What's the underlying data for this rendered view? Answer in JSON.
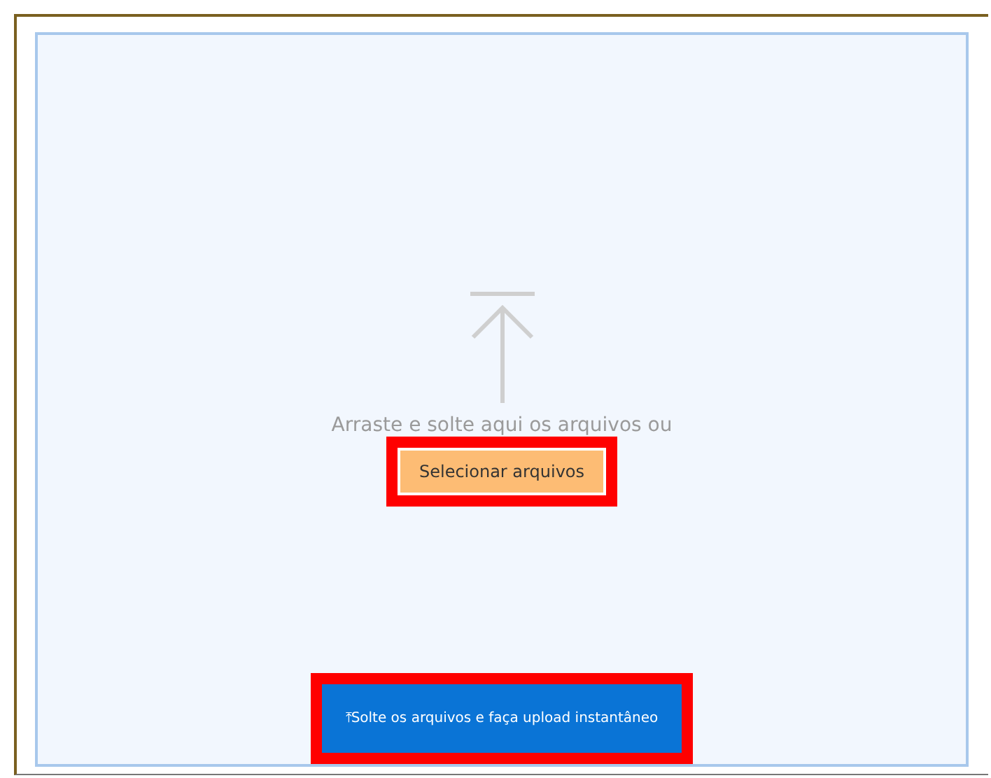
{
  "drop_zone": {
    "hint": "Arraste e solte aqui os arquivos ou",
    "select_button": {
      "label": "Selecionar arquivos",
      "highlighted": true
    },
    "upload_button": {
      "icon": "⤒",
      "label": "Solte os arquivos e faça upload instantâneo",
      "highlighted": true
    }
  }
}
